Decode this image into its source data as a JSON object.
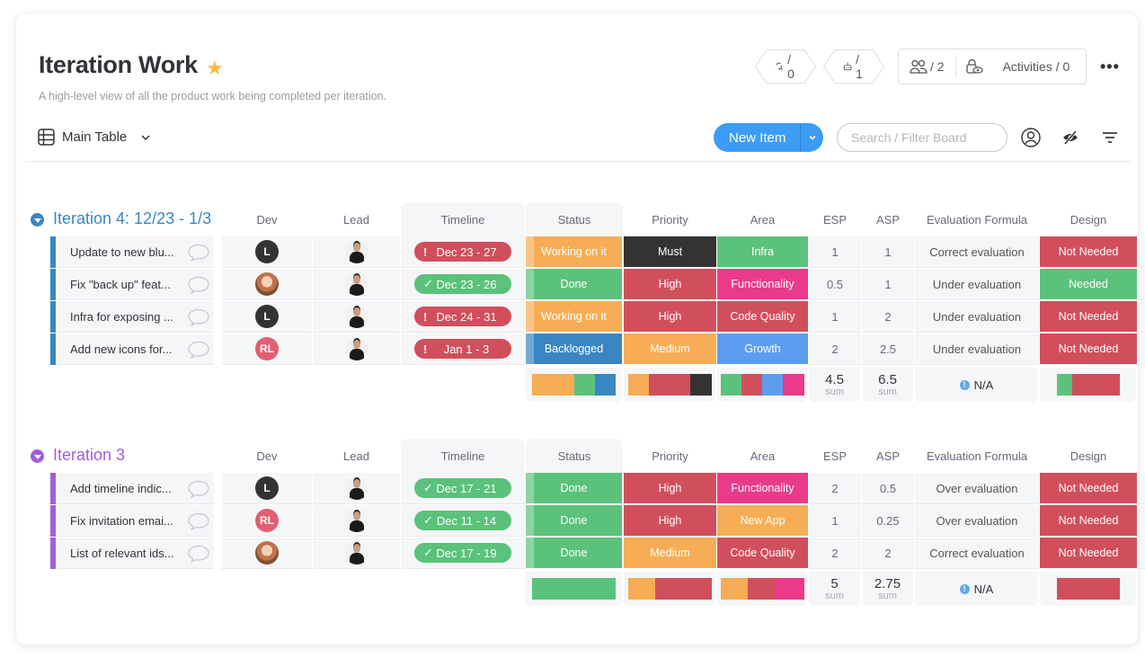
{
  "board": {
    "title": "Iteration Work",
    "description": "A high-level view of all the product work being completed per iteration.",
    "view_label": "Main Table"
  },
  "header": {
    "integrations_count": "/ 0",
    "automations_count": "/ 1",
    "members_count": "/ 2",
    "activities_label": "Activities / 0"
  },
  "toolbar": {
    "new_item_label": "New Item",
    "search_placeholder": "Search / Filter Board"
  },
  "columns": [
    "Dev",
    "Lead",
    "Timeline",
    "Status",
    "Priority",
    "Area",
    "ESP",
    "ASP",
    "Evaluation Formula",
    "Design"
  ],
  "colors": {
    "working": "#f6ad55",
    "done": "#5bc27b",
    "backlogged": "#3a86c2",
    "must": "#333333",
    "high": "#d14f5c",
    "medium": "#f6ad55",
    "infra": "#5bc27b",
    "functionality": "#ea3a8a",
    "code_quality": "#d14f5c",
    "growth": "#5b9ef0",
    "new_app": "#f6ad55",
    "not_needed": "#d14f5c",
    "needed": "#5bc27b",
    "group1": "#3a86c2",
    "group2": "#a25ddc"
  },
  "groups": [
    {
      "title": "Iteration 4: 12/23 - 1/3",
      "color": "#3a86c2",
      "rows": [
        {
          "name": "Update to new blu...",
          "dev": {
            "type": "initial",
            "label": "L"
          },
          "timeline": "Dec 23 - 27",
          "timeline_state": "overdue",
          "status": "Working on it",
          "priority": "Must",
          "area": "Infra",
          "esp": "1",
          "asp": "1",
          "evaluation": "Correct evaluation",
          "design": "Not Needed"
        },
        {
          "name": "Fix \"back up\" feat...",
          "dev": {
            "type": "photo",
            "label": ""
          },
          "timeline": "Dec 23 - 26",
          "timeline_state": "done",
          "status": "Done",
          "priority": "High",
          "area": "Functionality",
          "esp": "0.5",
          "asp": "1",
          "evaluation": "Under evaluation",
          "design": "Needed"
        },
        {
          "name": "Infra for exposing ...",
          "dev": {
            "type": "initial",
            "label": "L"
          },
          "timeline": "Dec 24 - 31",
          "timeline_state": "overdue",
          "status": "Working on it",
          "priority": "High",
          "area": "Code Quality",
          "esp": "1",
          "asp": "2",
          "evaluation": "Under evaluation",
          "design": "Not Needed"
        },
        {
          "name": "Add new icons for...",
          "dev": {
            "type": "rl",
            "label": "RL"
          },
          "timeline": "Jan 1 - 3",
          "timeline_state": "overdue",
          "status": "Backlogged",
          "priority": "Medium",
          "area": "Growth",
          "esp": "2",
          "asp": "2.5",
          "evaluation": "Under evaluation",
          "design": "Not Needed"
        }
      ],
      "summary": {
        "status_dist": [
          {
            "color": "#f6ad55",
            "share": 0.5
          },
          {
            "color": "#5bc27b",
            "share": 0.25
          },
          {
            "color": "#3a86c2",
            "share": 0.25
          }
        ],
        "priority_dist": [
          {
            "color": "#f6ad55",
            "share": 0.25
          },
          {
            "color": "#d14f5c",
            "share": 0.5
          },
          {
            "color": "#333333",
            "share": 0.25
          }
        ],
        "area_dist": [
          {
            "color": "#5bc27b",
            "share": 0.25
          },
          {
            "color": "#d14f5c",
            "share": 0.25
          },
          {
            "color": "#5b9ef0",
            "share": 0.25
          },
          {
            "color": "#ea3a8a",
            "share": 0.25
          }
        ],
        "esp_sum": "4.5",
        "asp_sum": "6.5",
        "sum_label": "sum",
        "evaluation_summary": "N/A",
        "design_dist": [
          {
            "color": "#5bc27b",
            "share": 0.25
          },
          {
            "color": "#d14f5c",
            "share": 0.75
          }
        ]
      }
    },
    {
      "title": "Iteration 3",
      "color": "#a25ddc",
      "rows": [
        {
          "name": "Add timeline indic...",
          "dev": {
            "type": "initial",
            "label": "L"
          },
          "timeline": "Dec 17 - 21",
          "timeline_state": "done",
          "status": "Done",
          "priority": "High",
          "area": "Functionality",
          "esp": "2",
          "asp": "0.5",
          "evaluation": "Over evaluation",
          "design": "Not Needed"
        },
        {
          "name": "Fix invitation emai...",
          "dev": {
            "type": "rl",
            "label": "RL"
          },
          "timeline": "Dec 11 - 14",
          "timeline_state": "done",
          "status": "Done",
          "priority": "High",
          "area": "New App",
          "esp": "1",
          "asp": "0.25",
          "evaluation": "Over evaluation",
          "design": "Not Needed"
        },
        {
          "name": "List of relevant ids...",
          "dev": {
            "type": "photo",
            "label": ""
          },
          "timeline": "Dec 17 - 19",
          "timeline_state": "done",
          "status": "Done",
          "priority": "Medium",
          "area": "Code Quality",
          "esp": "2",
          "asp": "2",
          "evaluation": "Correct evaluation",
          "design": "Not Needed"
        }
      ],
      "summary": {
        "status_dist": [
          {
            "color": "#5bc27b",
            "share": 1
          }
        ],
        "priority_dist": [
          {
            "color": "#f6ad55",
            "share": 0.333
          },
          {
            "color": "#d14f5c",
            "share": 0.667
          }
        ],
        "area_dist": [
          {
            "color": "#f6ad55",
            "share": 0.333
          },
          {
            "color": "#d14f5c",
            "share": 0.333
          },
          {
            "color": "#ea3a8a",
            "share": 0.334
          }
        ],
        "esp_sum": "5",
        "asp_sum": "2.75",
        "sum_label": "sum",
        "evaluation_summary": "N/A",
        "design_dist": [
          {
            "color": "#d14f5c",
            "share": 1
          }
        ]
      }
    }
  ]
}
